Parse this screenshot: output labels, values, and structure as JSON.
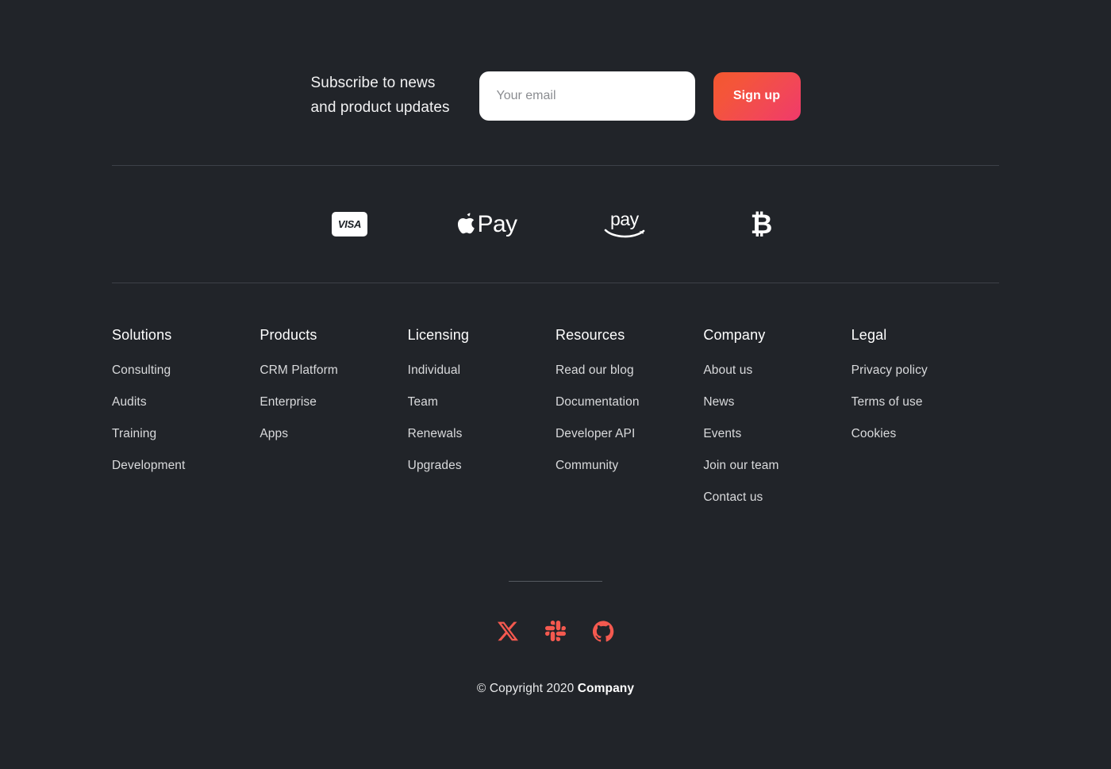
{
  "subscribe": {
    "line1": "Subscribe to news",
    "line2": "and product updates",
    "email_placeholder": "Your email",
    "email_value": "",
    "signup_label": "Sign up"
  },
  "payments": [
    {
      "name": "visa",
      "label": "VISA"
    },
    {
      "name": "apple-pay",
      "label": "Pay"
    },
    {
      "name": "amazon-pay",
      "label": "pay"
    },
    {
      "name": "bitcoin",
      "label": "₿"
    }
  ],
  "columns": [
    {
      "title": "Solutions",
      "links": [
        "Consulting",
        "Audits",
        "Training",
        "Development"
      ]
    },
    {
      "title": "Products",
      "links": [
        "CRM Platform",
        "Enterprise",
        "Apps"
      ]
    },
    {
      "title": "Licensing",
      "links": [
        "Individual",
        "Team",
        "Renewals",
        "Upgrades"
      ]
    },
    {
      "title": "Resources",
      "links": [
        "Read our blog",
        "Documentation",
        "Developer API",
        "Community"
      ]
    },
    {
      "title": "Company",
      "links": [
        "About us",
        "News",
        "Events",
        "Join our team",
        "Contact us"
      ]
    },
    {
      "title": "Legal",
      "links": [
        "Privacy policy",
        "Terms of use",
        "Cookies"
      ]
    }
  ],
  "socials": [
    {
      "name": "x-twitter",
      "label": "X"
    },
    {
      "name": "slack",
      "label": "Slack"
    },
    {
      "name": "github",
      "label": "GitHub"
    }
  ],
  "copyright": {
    "prefix": "© Copyright 2020 ",
    "company": "Company"
  },
  "colors": {
    "background": "#212429",
    "accent": "#f4594f",
    "button_gradient_start": "#f2572f",
    "button_gradient_end": "#f03a6b",
    "divider": "#3d4148",
    "heading_text": "#ffffff",
    "link_text": "#d9dadc"
  }
}
